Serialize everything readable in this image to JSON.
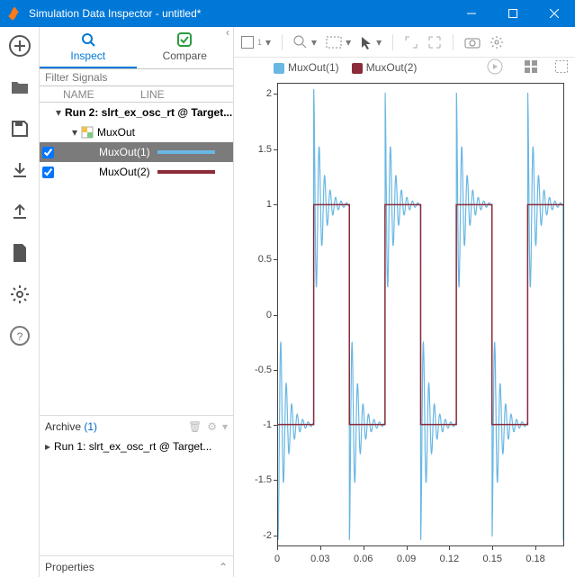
{
  "window": {
    "title": "Simulation Data Inspector - untitled*"
  },
  "tabs": {
    "inspect": "Inspect",
    "compare": "Compare"
  },
  "filter": {
    "placeholder": "Filter Signals"
  },
  "columns": {
    "name": "NAME",
    "line": "LINE"
  },
  "tree": {
    "run": "Run 2: slrt_ex_osc_rt @ Target...",
    "mux": "MuxOut",
    "sig1": "MuxOut(1)",
    "sig2": "MuxOut(2)"
  },
  "archive": {
    "label": "Archive",
    "count": "(1)",
    "run": "Run 1: slrt_ex_osc_rt @ Target..."
  },
  "properties": {
    "label": "Properties"
  },
  "legend": {
    "s1": "MuxOut(1)",
    "s2": "MuxOut(2)"
  },
  "colors": {
    "s1": "#69b7e3",
    "s2": "#8b2b3a"
  },
  "chart_data": {
    "type": "line",
    "xlabel": "",
    "ylabel": "",
    "xlim": [
      0,
      0.2
    ],
    "ylim": [
      -2.1,
      2.1
    ],
    "xticks": [
      0,
      0.03,
      0.06,
      0.09,
      0.12,
      0.15,
      0.18
    ],
    "yticks": [
      -2.0,
      -1.5,
      -1.0,
      -0.5,
      0,
      0.5,
      1.0,
      1.5,
      2.0
    ],
    "series": [
      {
        "name": "MuxOut(1)",
        "color": "#69b7e3",
        "note": "ringing sine ~20Hz envelope on 50ms square"
      },
      {
        "name": "MuxOut(2)",
        "color": "#8b2b3a",
        "x": [
          0,
          0.025,
          0.025,
          0.05,
          0.05,
          0.075,
          0.075,
          0.1,
          0.1,
          0.125,
          0.125,
          0.15,
          0.15,
          0.175,
          0.175,
          0.2
        ],
        "y": [
          -1,
          -1,
          1,
          1,
          -1,
          -1,
          1,
          1,
          -1,
          -1,
          1,
          1,
          -1,
          -1,
          1,
          1
        ]
      }
    ]
  }
}
